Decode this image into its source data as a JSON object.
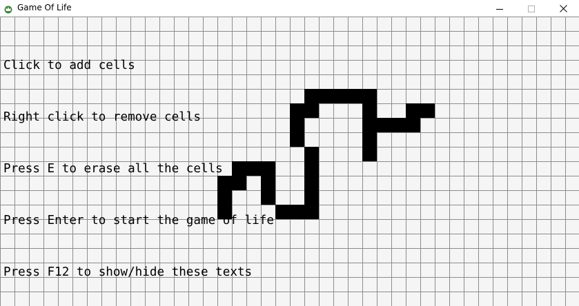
{
  "window": {
    "title": "Game Of Life",
    "app_icon": "crown-icon",
    "controls": [
      "minimize-icon",
      "maximize-icon",
      "close-icon"
    ]
  },
  "help_text": {
    "lines": [
      "Click to add cells",
      "Right click to remove cells",
      "Press E to erase all the cells",
      "Press Enter to start the game of life",
      "Press F12 to show/hide these texts"
    ]
  },
  "grid": {
    "cell_color": "#000000",
    "line_color": "#8c8c8c",
    "background": "#f5f5f5",
    "live_cells": [
      [
        21,
        5
      ],
      [
        22,
        5
      ],
      [
        23,
        5
      ],
      [
        24,
        5
      ],
      [
        25,
        5
      ],
      [
        20,
        6
      ],
      [
        21,
        6
      ],
      [
        25,
        6
      ],
      [
        28,
        6
      ],
      [
        29,
        6
      ],
      [
        20,
        7
      ],
      [
        25,
        7
      ],
      [
        26,
        7
      ],
      [
        27,
        7
      ],
      [
        28,
        7
      ],
      [
        20,
        8
      ],
      [
        25,
        8
      ],
      [
        21,
        9
      ],
      [
        25,
        9
      ],
      [
        16,
        10
      ],
      [
        17,
        10
      ],
      [
        18,
        10
      ],
      [
        21,
        10
      ],
      [
        15,
        11
      ],
      [
        16,
        11
      ],
      [
        18,
        11
      ],
      [
        21,
        11
      ],
      [
        15,
        12
      ],
      [
        18,
        12
      ],
      [
        21,
        12
      ],
      [
        15,
        13
      ],
      [
        19,
        13
      ],
      [
        20,
        13
      ],
      [
        21,
        13
      ]
    ]
  }
}
